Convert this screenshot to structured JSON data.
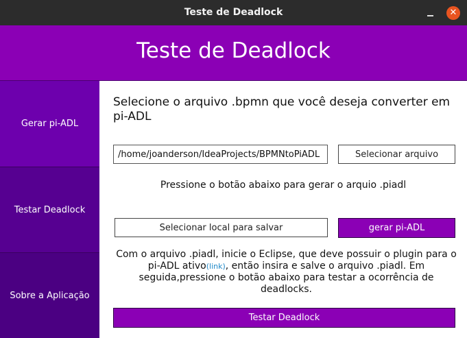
{
  "window": {
    "title": "Teste de Deadlock",
    "close_glyph": "✕"
  },
  "banner": {
    "title": "Teste de Deadlock"
  },
  "sidebar": {
    "items": [
      {
        "label": "Gerar pi-ADL"
      },
      {
        "label": "Testar Deadlock"
      },
      {
        "label": "Sobre a Aplicação"
      }
    ]
  },
  "main": {
    "heading": "Selecione o arquivo .bpmn que você deseja converter em pi-ADL",
    "path_value": "/home/joanderson/IdeaProjects/BPMNtoPiADL",
    "select_file_label": "Selecionar arquivo",
    "instruction": "Pressione o botão abaixo para gerar o arquio .piadl",
    "select_save_label": "Selecionar local para salvar",
    "generate_label": "gerar pi-ADL",
    "paragraph_before": "Com o arquivo .piadl, inicie o Eclipse, que deve possuir o plugin para o pi-ADL ativo",
    "link_text": "(link)",
    "paragraph_after": ", então insira e salve o arquivo .piadl. Em seguida,pressione o botão abaixo para testar a ocorrência de deadlocks.",
    "test_label": "Testar Deadlock"
  },
  "colors": {
    "accent": "#8b00b5",
    "sidebar_active": "#6d00ad",
    "sidebar_item": "#560091",
    "link": "#1e88c8",
    "close_button": "#e95420"
  },
  "icons": {
    "minimize": "minimize-icon",
    "close": "close-icon"
  }
}
